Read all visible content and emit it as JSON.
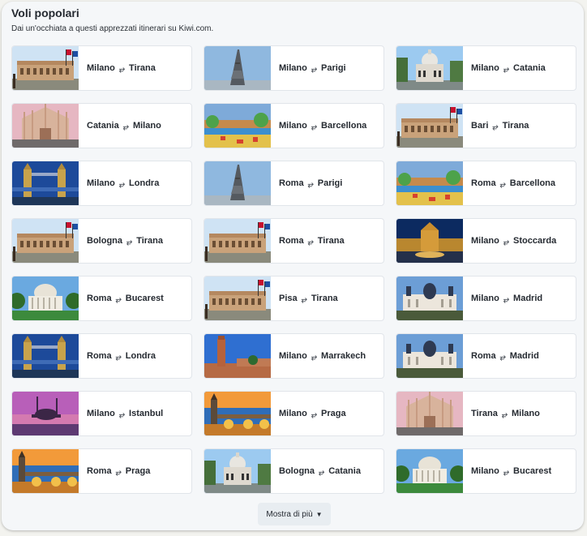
{
  "header": {
    "title": "Voli popolari",
    "subtitle": "Dai un'occhiata a questi apprezzati itinerari su Kiwi.com."
  },
  "arrow_glyph": "⥂",
  "routes": [
    {
      "from": "Milano",
      "to": "Tirana",
      "image": "tirana-palace"
    },
    {
      "from": "Milano",
      "to": "Parigi",
      "image": "eiffel-tower"
    },
    {
      "from": "Milano",
      "to": "Catania",
      "image": "catania-church"
    },
    {
      "from": "Catania",
      "to": "Milano",
      "image": "milan-cathedral"
    },
    {
      "from": "Milano",
      "to": "Barcellona",
      "image": "park-guell"
    },
    {
      "from": "Bari",
      "to": "Tirana",
      "image": "tirana-palace"
    },
    {
      "from": "Milano",
      "to": "Londra",
      "image": "tower-bridge"
    },
    {
      "from": "Roma",
      "to": "Parigi",
      "image": "eiffel-tower"
    },
    {
      "from": "Roma",
      "to": "Barcellona",
      "image": "park-guell"
    },
    {
      "from": "Bologna",
      "to": "Tirana",
      "image": "tirana-palace"
    },
    {
      "from": "Roma",
      "to": "Tirana",
      "image": "tirana-palace"
    },
    {
      "from": "Milano",
      "to": "Stoccarda",
      "image": "stuttgart-night"
    },
    {
      "from": "Roma",
      "to": "Bucarest",
      "image": "bucharest-athenaeum"
    },
    {
      "from": "Pisa",
      "to": "Tirana",
      "image": "tirana-palace"
    },
    {
      "from": "Milano",
      "to": "Madrid",
      "image": "madrid-cathedral"
    },
    {
      "from": "Roma",
      "to": "Londra",
      "image": "tower-bridge"
    },
    {
      "from": "Milano",
      "to": "Marrakech",
      "image": "marrakech-mosque"
    },
    {
      "from": "Roma",
      "to": "Madrid",
      "image": "madrid-cathedral"
    },
    {
      "from": "Milano",
      "to": "Istanbul",
      "image": "istanbul-sunset"
    },
    {
      "from": "Milano",
      "to": "Praga",
      "image": "prague-bridge"
    },
    {
      "from": "Tirana",
      "to": "Milano",
      "image": "milan-cathedral"
    },
    {
      "from": "Roma",
      "to": "Praga",
      "image": "prague-bridge"
    },
    {
      "from": "Bologna",
      "to": "Catania",
      "image": "catania-church"
    },
    {
      "from": "Milano",
      "to": "Bucarest",
      "image": "bucharest-athenaeum"
    }
  ],
  "show_more": {
    "label": "Mostra di più",
    "icon": "chevron-down-icon"
  }
}
